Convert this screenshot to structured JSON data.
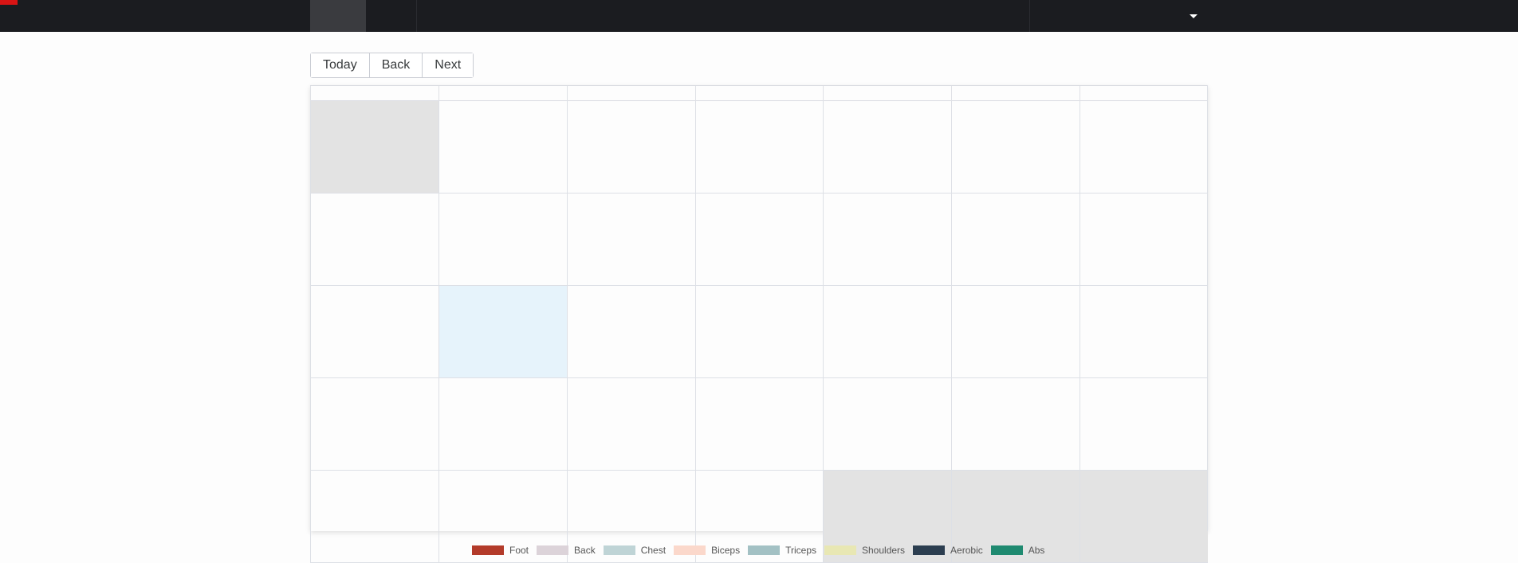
{
  "toolbar": {
    "today_label": "Today",
    "back_label": "Back",
    "next_label": "Next"
  },
  "calendar": {
    "weeks": [
      [
        "off",
        "",
        "",
        "",
        "",
        "",
        ""
      ],
      [
        "",
        "",
        "",
        "",
        "",
        "",
        ""
      ],
      [
        "",
        "today",
        "",
        "",
        "",
        "",
        ""
      ],
      [
        "",
        "",
        "",
        "",
        "",
        "",
        ""
      ],
      [
        "",
        "",
        "",
        "",
        "off",
        "off",
        "off"
      ]
    ]
  },
  "legend": [
    {
      "label": "Foot",
      "color": "#b33b2a"
    },
    {
      "label": "Back",
      "color": "#dcd3d9"
    },
    {
      "label": "Chest",
      "color": "#bfd4d6"
    },
    {
      "label": "Biceps",
      "color": "#fbd8cb"
    },
    {
      "label": "Triceps",
      "color": "#a3c1c4"
    },
    {
      "label": "Shoulders",
      "color": "#e8e7b3"
    },
    {
      "label": "Aerobic",
      "color": "#2c3e50"
    },
    {
      "label": "Abs",
      "color": "#1f8a70"
    }
  ],
  "colors": {
    "navbar": "#1b1c20",
    "brand": "#d91414",
    "today_bg": "#e6f3fb",
    "off_range_bg": "#e3e3e3"
  }
}
